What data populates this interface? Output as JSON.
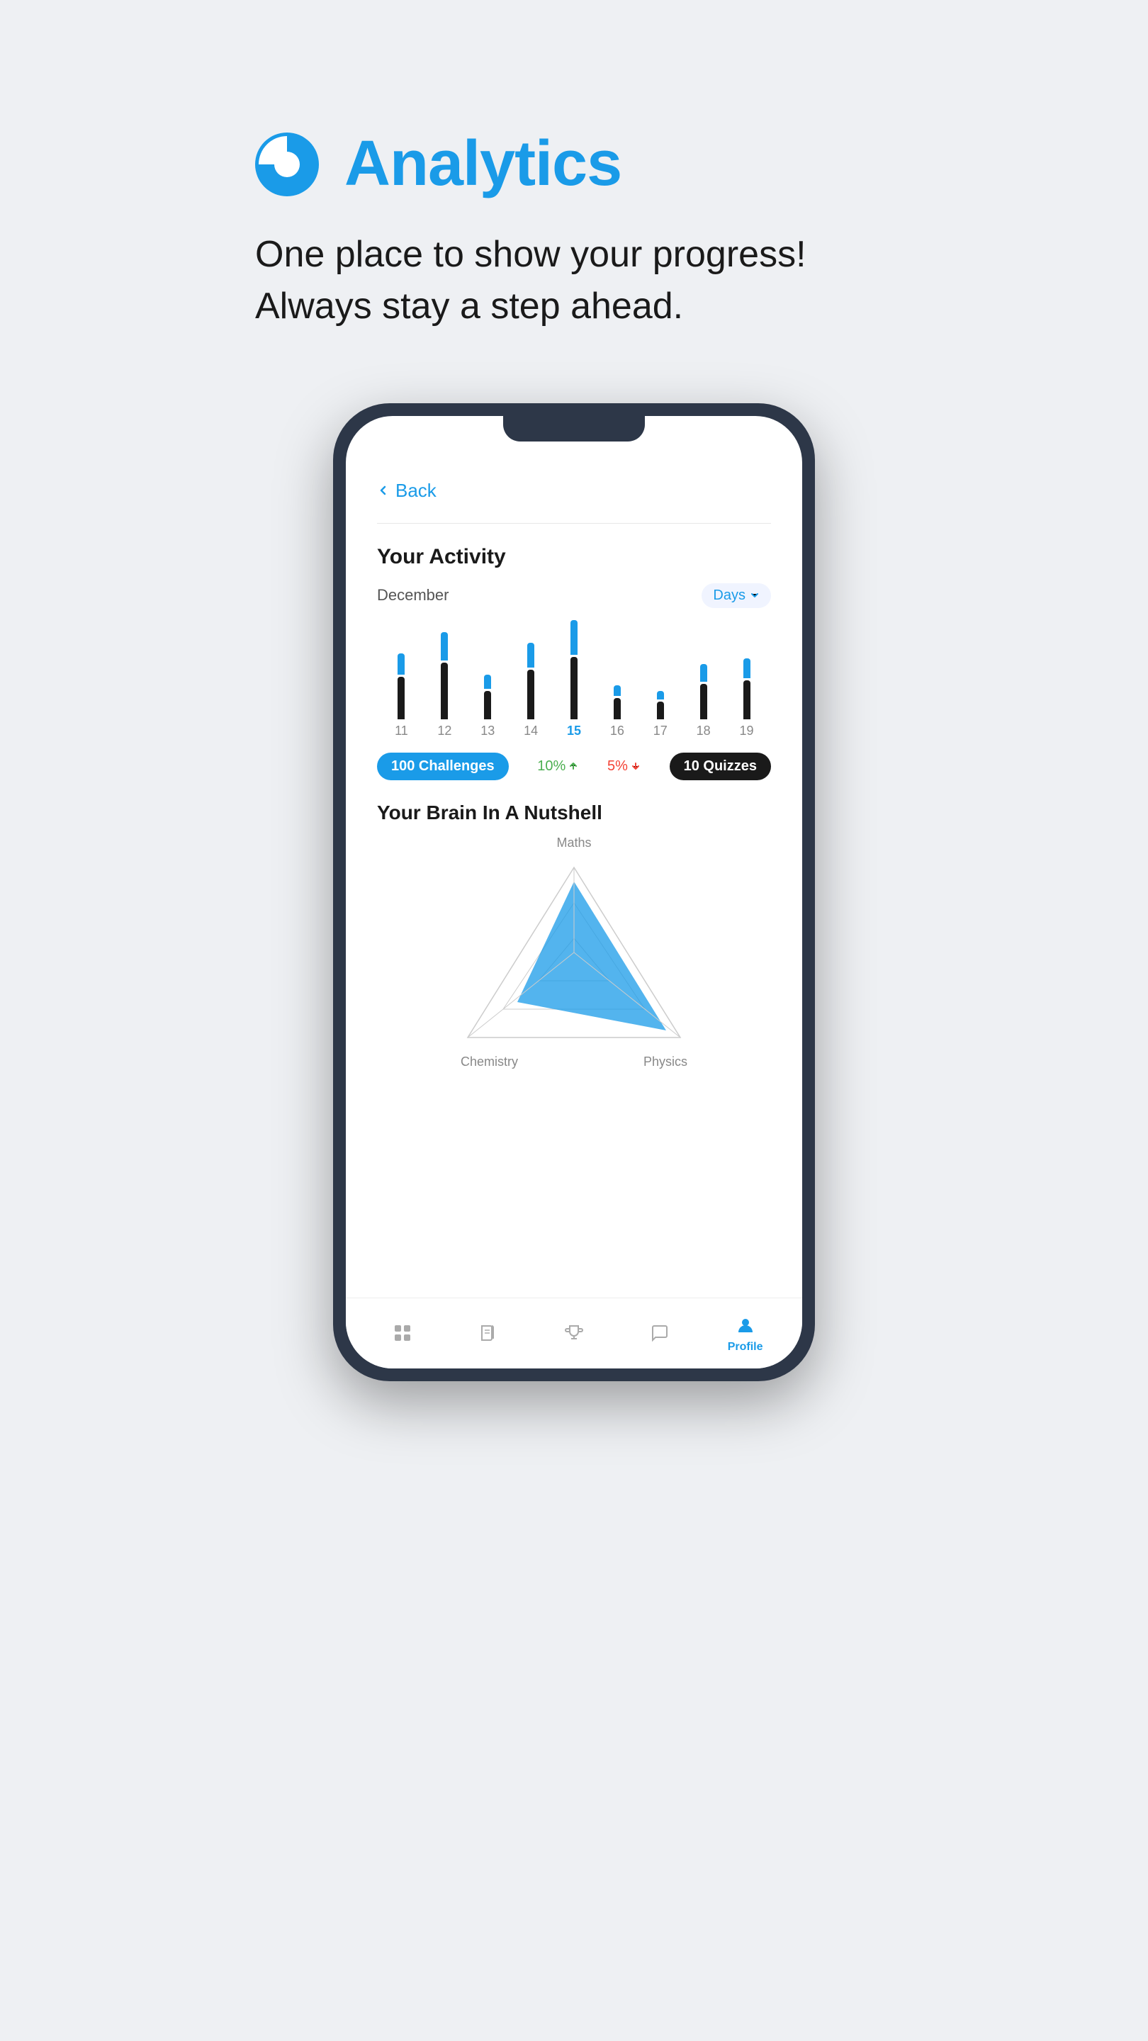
{
  "page": {
    "background": "#eef0f3"
  },
  "header": {
    "icon": "analytics-icon",
    "title": "Analytics",
    "subtitle_line1": "One place to show your progress!",
    "subtitle_line2": "Always stay a step ahead."
  },
  "phone": {
    "back_label": "Back",
    "activity": {
      "section_title": "Your Activity",
      "month": "December",
      "filter_label": "Days",
      "bars": [
        {
          "day": "11",
          "dark_h": 60,
          "blue_h": 30,
          "highlight": false
        },
        {
          "day": "12",
          "dark_h": 80,
          "blue_h": 40,
          "highlight": false
        },
        {
          "day": "13",
          "dark_h": 40,
          "blue_h": 20,
          "highlight": false
        },
        {
          "day": "14",
          "dark_h": 70,
          "blue_h": 35,
          "highlight": false
        },
        {
          "day": "15",
          "dark_h": 90,
          "blue_h": 50,
          "highlight": true
        },
        {
          "day": "16",
          "dark_h": 30,
          "blue_h": 15,
          "highlight": false
        },
        {
          "day": "17",
          "dark_h": 25,
          "blue_h": 12,
          "highlight": false
        },
        {
          "day": "18",
          "dark_h": 50,
          "blue_h": 25,
          "highlight": false
        },
        {
          "day": "19",
          "dark_h": 55,
          "blue_h": 28,
          "highlight": false
        }
      ],
      "stats": {
        "challenges": "100 Challenges",
        "change_up": "10%",
        "change_down": "5%",
        "quizzes": "10 Quizzes"
      }
    },
    "brain": {
      "section_title": "Your Brain In A Nutshell",
      "labels": {
        "top": "Maths",
        "bottom_left": "Chemistry",
        "bottom_right": "Physics"
      }
    },
    "nav": {
      "items": [
        {
          "label": "",
          "icon": "home-icon",
          "active": false
        },
        {
          "label": "",
          "icon": "book-icon",
          "active": false
        },
        {
          "label": "",
          "icon": "trophy-icon",
          "active": false
        },
        {
          "label": "",
          "icon": "chat-icon",
          "active": false
        },
        {
          "label": "Profile",
          "icon": "profile-icon",
          "active": true
        }
      ]
    }
  }
}
